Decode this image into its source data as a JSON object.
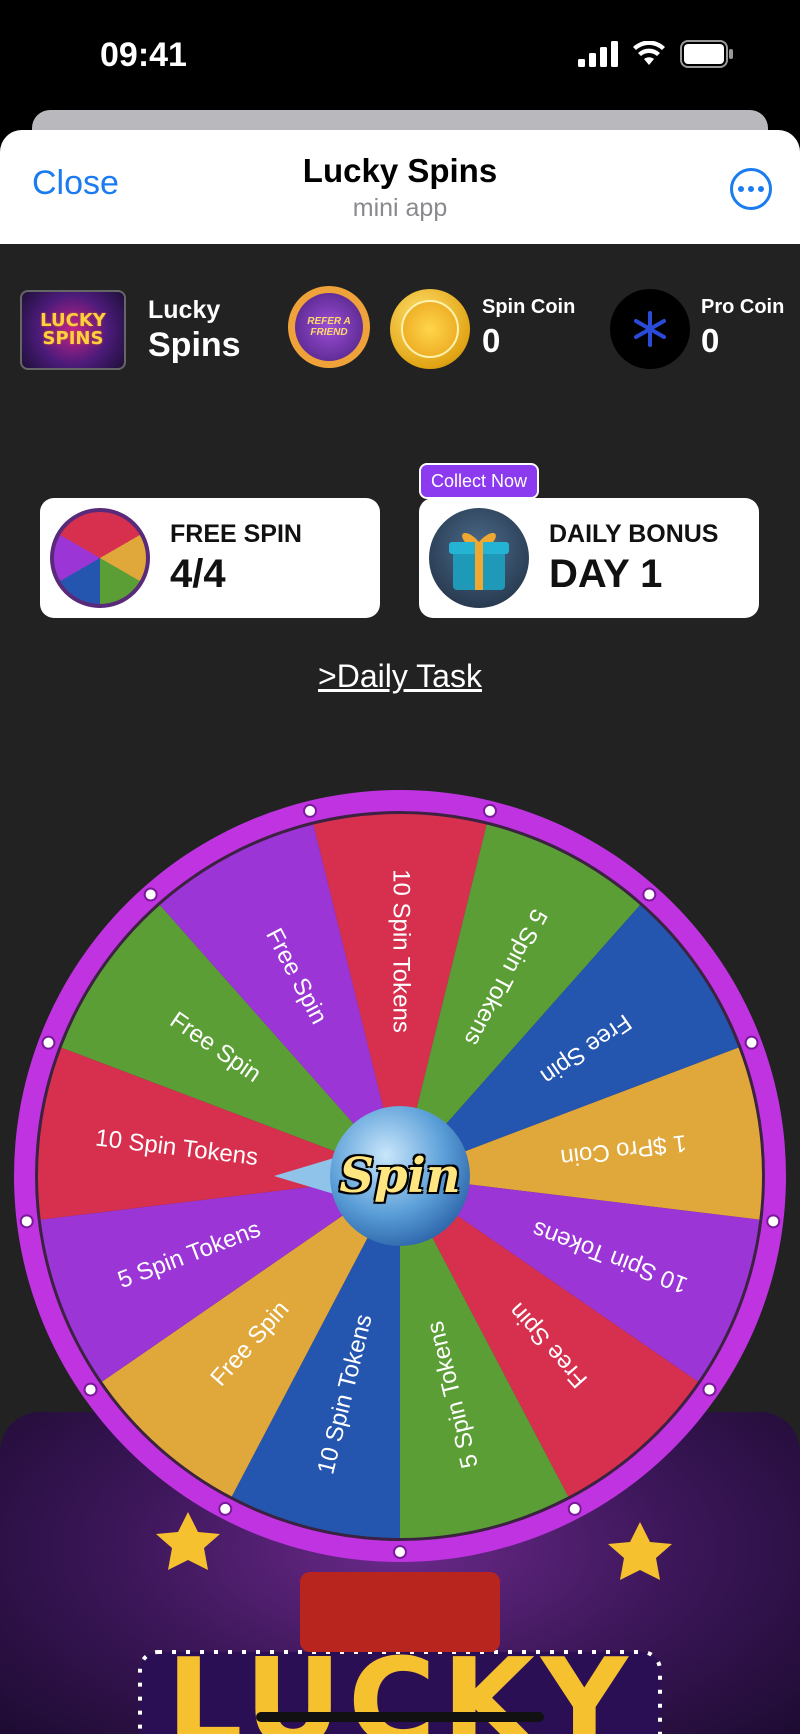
{
  "status": {
    "time": "09:41"
  },
  "nav": {
    "close": "Close",
    "title": "Lucky Spins",
    "subtitle": "mini app"
  },
  "header": {
    "logo_line1": "LUCKY",
    "logo_line2": "SPINS",
    "app_name_line1": "Lucky",
    "app_name_line2": "Spins",
    "refer_line1": "REFER A",
    "refer_line2": "FRIEND",
    "spin_coin_label": "Spin Coin",
    "spin_coin_value": "0",
    "pro_coin_label": "Pro Coin",
    "pro_coin_value": "0"
  },
  "cards": {
    "free_spin_label": "FREE SPIN",
    "free_spin_value": "4/4",
    "daily_bonus_label": "DAILY BONUS",
    "daily_bonus_value": "DAY 1",
    "collect_now": "Collect Now"
  },
  "daily_task": ">Daily Task",
  "wheel": {
    "center_label": "Spin",
    "segments": [
      {
        "label": "10 Spin Tokens",
        "color": "#d7304f"
      },
      {
        "label": "5 Spin Tokens",
        "color": "#5c9e36"
      },
      {
        "label": "Free Spin",
        "color": "#2456b0"
      },
      {
        "label": "1 $Pro Coin",
        "color": "#e0a83a"
      },
      {
        "label": "10 Spin Tokens",
        "color": "#9b35d6"
      },
      {
        "label": "Free Spin",
        "color": "#d7304f"
      },
      {
        "label": "5 Spin Tokens",
        "color": "#5c9e36"
      },
      {
        "label": "10 Spin Tokens",
        "color": "#2456b0"
      },
      {
        "label": "Free Spin",
        "color": "#e0a83a"
      },
      {
        "label": "5 Spin Tokens",
        "color": "#9b35d6"
      },
      {
        "label": "10 Spin Tokens",
        "color": "#d7304f"
      },
      {
        "label": "Free Spin",
        "color": "#5c9e36"
      },
      {
        "label": "Free Spin",
        "color": "#9b35d6"
      }
    ],
    "rim_color": "#c033e0"
  },
  "banner": {
    "title": "LUCKY"
  }
}
